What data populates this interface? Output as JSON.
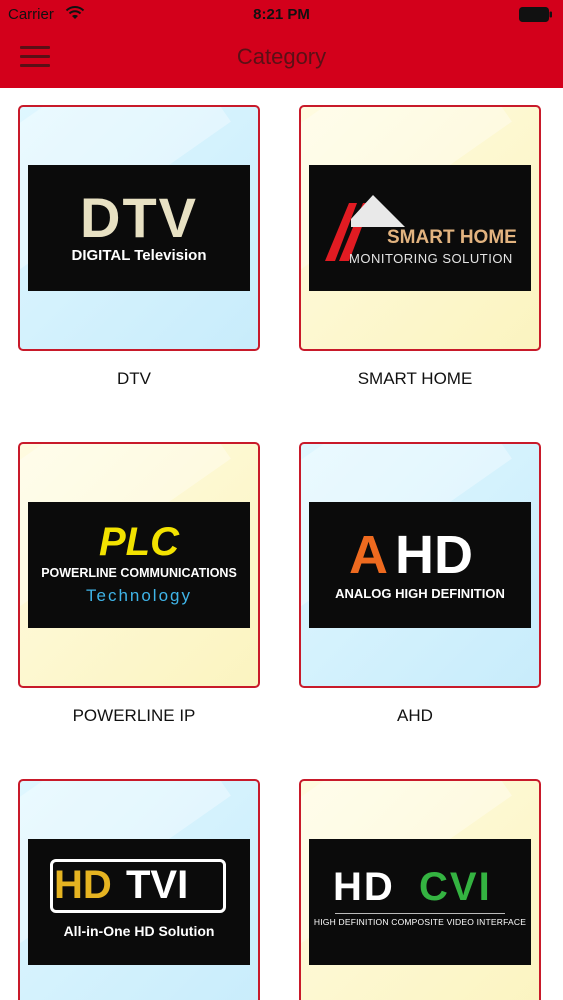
{
  "status_bar": {
    "carrier": "Carrier",
    "time": "8:21 PM",
    "wifi_icon": "wifi-icon",
    "battery_icon": "battery-icon"
  },
  "header": {
    "title": "Category",
    "menu_icon": "hamburger-menu-icon",
    "background_color": "#d3001b"
  },
  "categories": [
    {
      "label": "DTV",
      "card_color": "blue",
      "logo": {
        "line1": "DTV",
        "line2": "DIGITAL Television"
      }
    },
    {
      "label": "SMART HOME",
      "card_color": "yellow",
      "logo": {
        "line1": "SMART HOME",
        "line2": "MONITORING SOLUTION"
      }
    },
    {
      "label": "POWERLINE IP",
      "card_color": "yellow",
      "logo": {
        "line1": "PLC",
        "line2": "POWERLINE COMMUNICATIONS",
        "line3": "Technology"
      }
    },
    {
      "label": "AHD",
      "card_color": "blue",
      "logo": {
        "line1a": "A",
        "line1b": "HD",
        "line2": "ANALOG HIGH DEFINITION"
      }
    },
    {
      "label": "",
      "card_color": "blue",
      "logo": {
        "line1a": "HD",
        "line1b": "TVI",
        "line2": "All-in-One HD Solution"
      }
    },
    {
      "label": "",
      "card_color": "yellow",
      "logo": {
        "line1a": "HD",
        "line1b": "CVI",
        "line2": "HIGH DEFINITION COMPOSITE VIDEO INTERFACE"
      }
    }
  ]
}
